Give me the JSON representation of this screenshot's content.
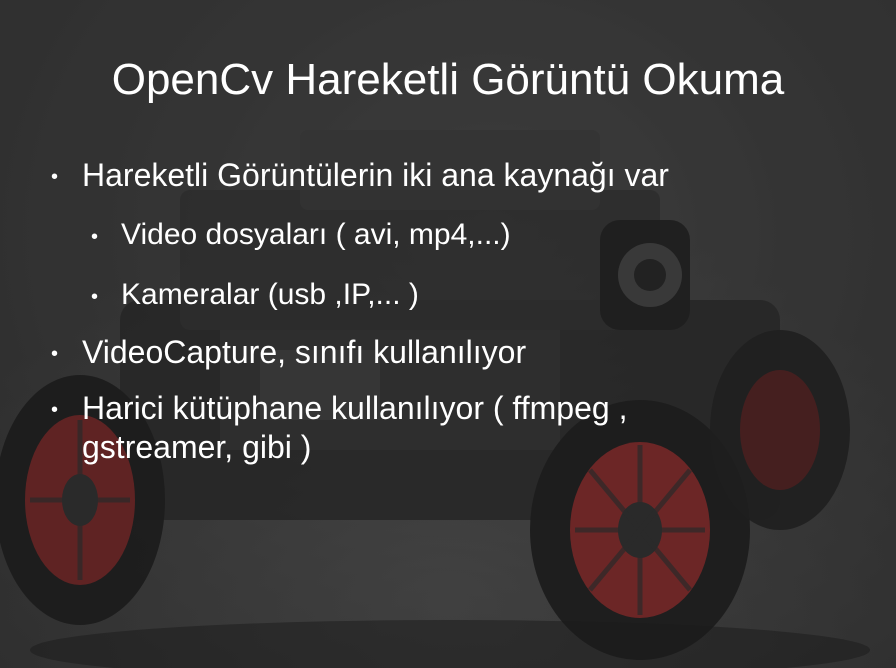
{
  "slide": {
    "title": "OpenCv Hareketli Görüntü Okuma",
    "bullets": [
      {
        "level": 1,
        "text": "Hareketli Görüntülerin iki ana kaynağı var"
      },
      {
        "level": 2,
        "text": "Video dosyaları ( avi, mp4,...)"
      },
      {
        "level": 2,
        "text": "Kameralar (usb ,IP,... )"
      },
      {
        "level": 1,
        "text": "VideoCapture, sınıfı kullanılıyor"
      },
      {
        "level": 1,
        "line1": "Harici kütüphane kullanılıyor ( ffmpeg ,",
        "line2": "gstreamer, gibi )"
      }
    ],
    "bullet_symbol": "•",
    "background_icon": "robot-car-photo",
    "colors": {
      "text": "#ffffff",
      "background": "#3a3a3a",
      "wheel": "#8a2a2a"
    }
  }
}
